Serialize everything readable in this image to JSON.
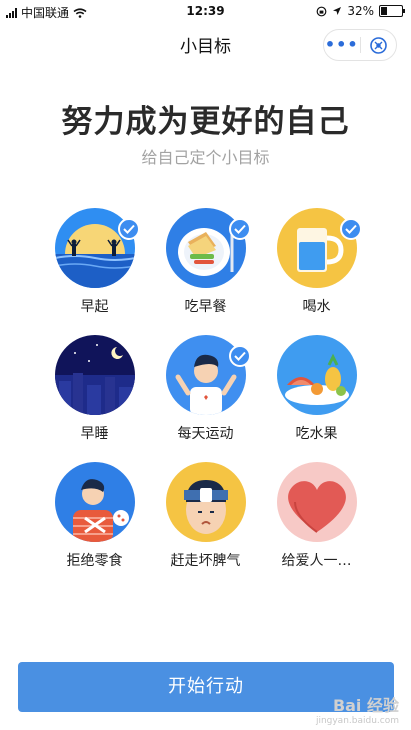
{
  "status_bar": {
    "carrier": "中国联通",
    "time": "12:39",
    "battery": "32%"
  },
  "nav": {
    "title": "小目标",
    "more_label": "•••"
  },
  "header": {
    "headline": "努力成为更好的自己",
    "subtitle": "给自己定个小目标"
  },
  "goals": [
    {
      "label": "早起",
      "icon": "sunrise-icon",
      "checked": true
    },
    {
      "label": "吃早餐",
      "icon": "breakfast-plate-icon",
      "checked": true
    },
    {
      "label": "喝水",
      "icon": "water-cup-icon",
      "checked": true
    },
    {
      "label": "早睡",
      "icon": "night-sky-icon",
      "checked": false
    },
    {
      "label": "每天运动",
      "icon": "exercise-person-icon",
      "checked": true
    },
    {
      "label": "吃水果",
      "icon": "fruit-plate-icon",
      "checked": false
    },
    {
      "label": "拒绝零食",
      "icon": "refuse-snack-person-icon",
      "checked": false
    },
    {
      "label": "赶走坏脾气",
      "icon": "headband-face-icon",
      "checked": false
    },
    {
      "label": "给爱人一…",
      "icon": "heart-icon",
      "checked": false
    }
  ],
  "action": {
    "start_label": "开始行动"
  },
  "watermark": {
    "main": "Bai 经验",
    "url": "jingyan.baidu.com"
  },
  "colors": {
    "accent": "#4a90e2",
    "check": "#3d8df0",
    "headline": "#2a2a2a",
    "subtitle": "#a3a3a3"
  }
}
